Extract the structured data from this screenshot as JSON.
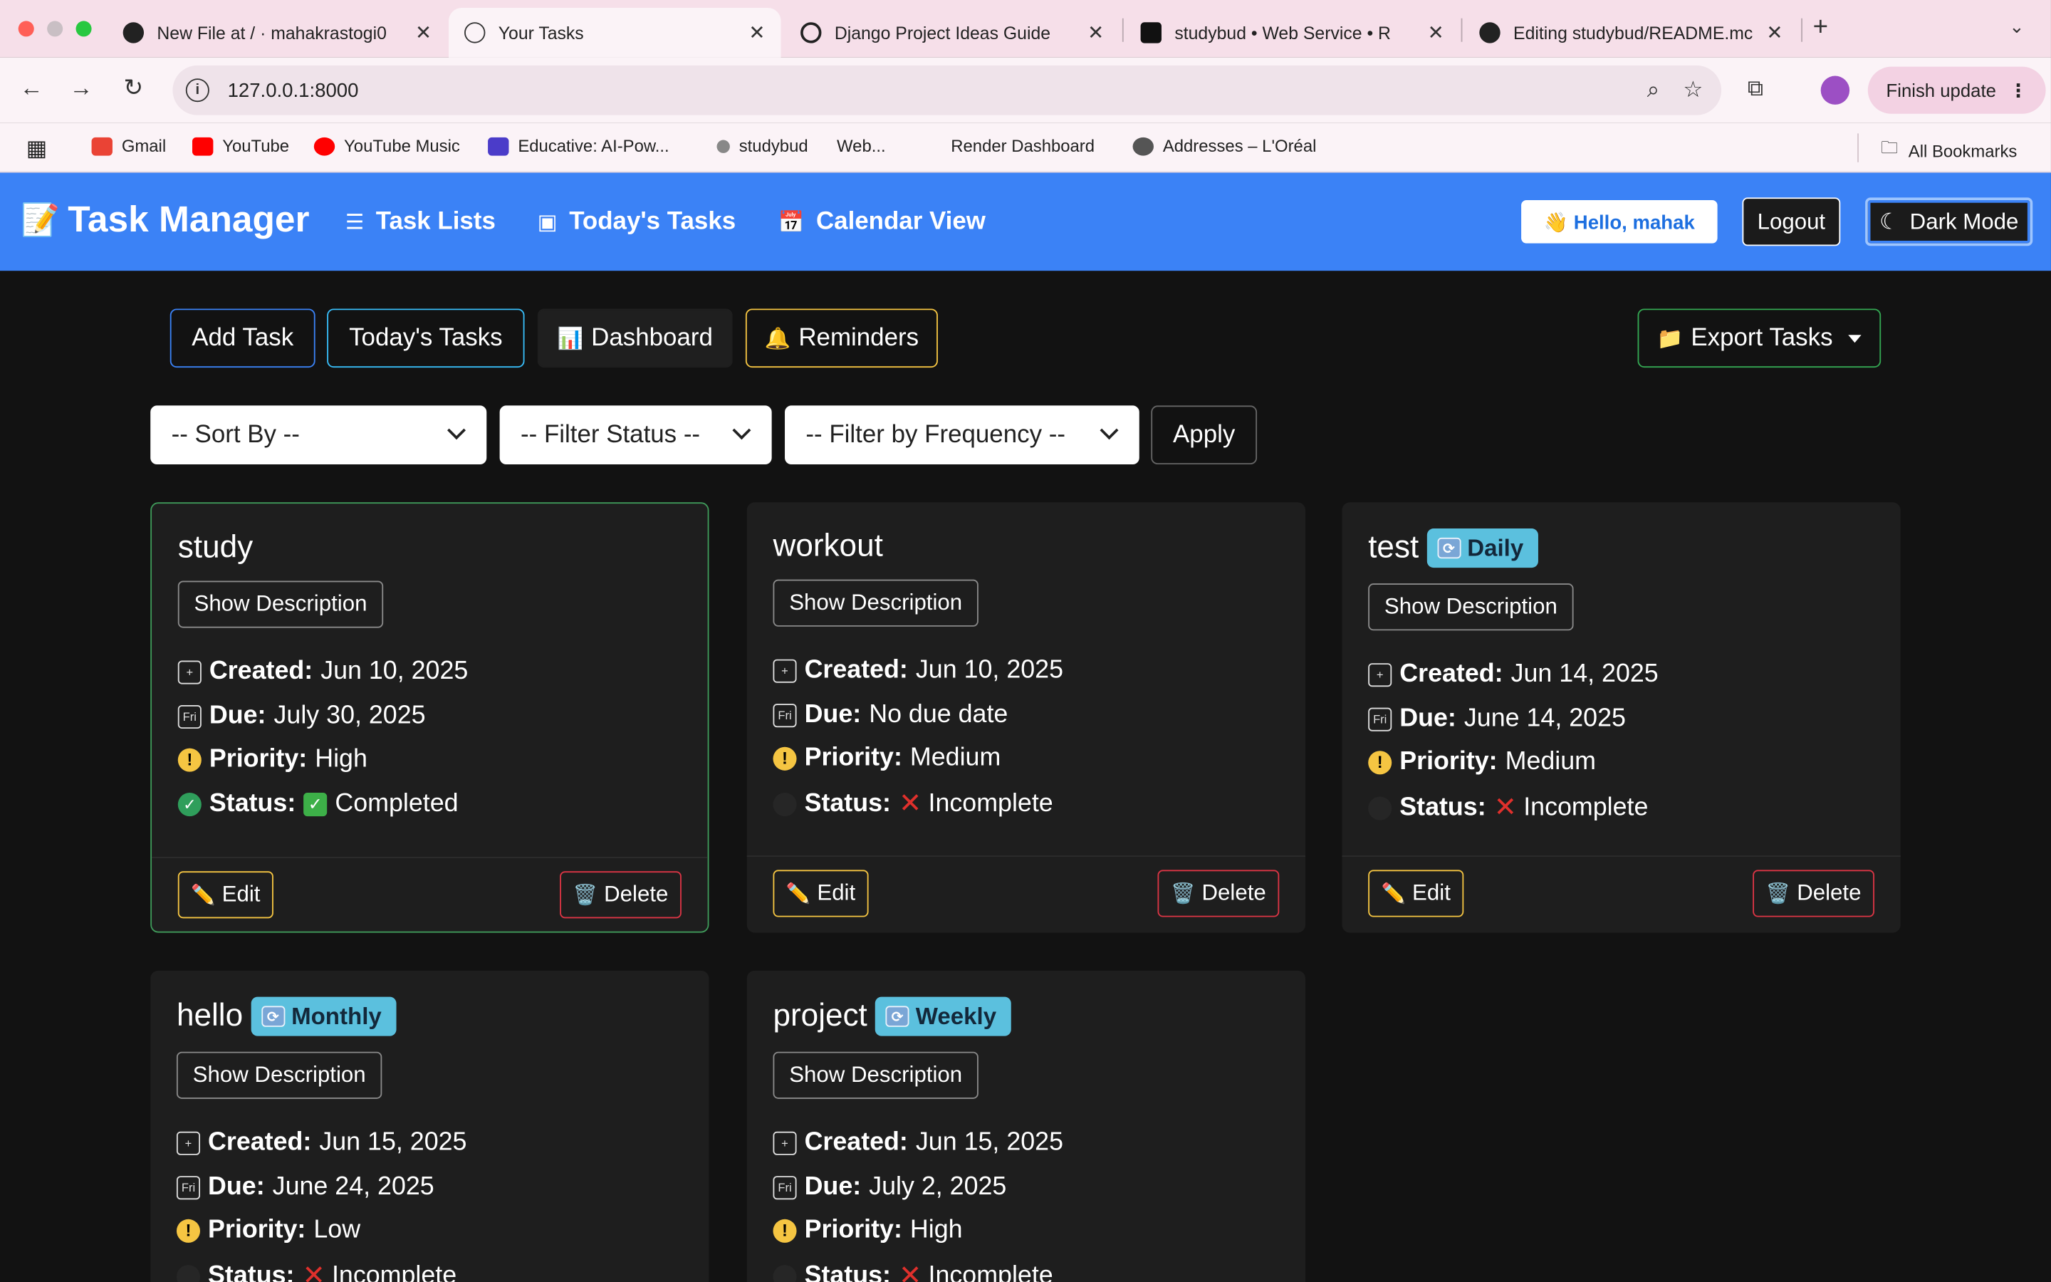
{
  "browser": {
    "tabs": [
      {
        "title": "New File at / · mahakrastogi0",
        "favicon": "github-icon"
      },
      {
        "title": "Your Tasks",
        "favicon": "globe-icon"
      },
      {
        "title": "Django Project Ideas Guide",
        "favicon": "openai-icon"
      },
      {
        "title": "studybud • Web Service • R",
        "favicon": "render-icon"
      },
      {
        "title": "Editing studybud/README.mc",
        "favicon": "github-icon"
      }
    ],
    "url": "127.0.0.1:8000",
    "finish_update": "Finish update",
    "bookmarks": [
      "Gmail",
      "YouTube",
      "YouTube Music",
      "Educative: AI-Pow...",
      "studybud",
      "Web...",
      "Render Dashboard",
      "Addresses – L'Oréal"
    ],
    "all_bookmarks": "All Bookmarks"
  },
  "nav": {
    "brand": "Task Manager",
    "links": [
      "Task Lists",
      "Today's Tasks",
      "Calendar View"
    ],
    "hello": "👋 Hello, mahak",
    "logout": "Logout",
    "dark_mode": "Dark Mode"
  },
  "actions": {
    "add_task": "Add Task",
    "todays_tasks": "Today's Tasks",
    "dashboard": "Dashboard",
    "reminders": "Reminders",
    "export": "Export Tasks"
  },
  "filters": {
    "sort": "-- Sort By --",
    "status": "-- Filter Status --",
    "frequency": "-- Filter by Frequency --",
    "apply": "Apply"
  },
  "labels": {
    "show_description": "Show Description",
    "created": "Created:",
    "due": "Due:",
    "priority": "Priority:",
    "status": "Status:",
    "edit": "Edit",
    "delete": "Delete"
  },
  "tasks": [
    {
      "title": "study",
      "frequency": "",
      "created": "Jun 10, 2025",
      "due": "July 30, 2025",
      "priority": "High",
      "status": "Completed"
    },
    {
      "title": "workout",
      "frequency": "",
      "created": "Jun 10, 2025",
      "due": "No due date",
      "priority": "Medium",
      "status": "Incomplete"
    },
    {
      "title": "test",
      "frequency": "Daily",
      "created": "Jun 14, 2025",
      "due": "June 14, 2025",
      "priority": "Medium",
      "status": "Incomplete"
    },
    {
      "title": "hello",
      "frequency": "Monthly",
      "created": "Jun 15, 2025",
      "due": "June 24, 2025",
      "priority": "Low",
      "status": "Incomplete"
    },
    {
      "title": "project",
      "frequency": "Weekly",
      "created": "Jun 15, 2025",
      "due": "July 2, 2025",
      "priority": "High",
      "status": "Incomplete"
    }
  ]
}
